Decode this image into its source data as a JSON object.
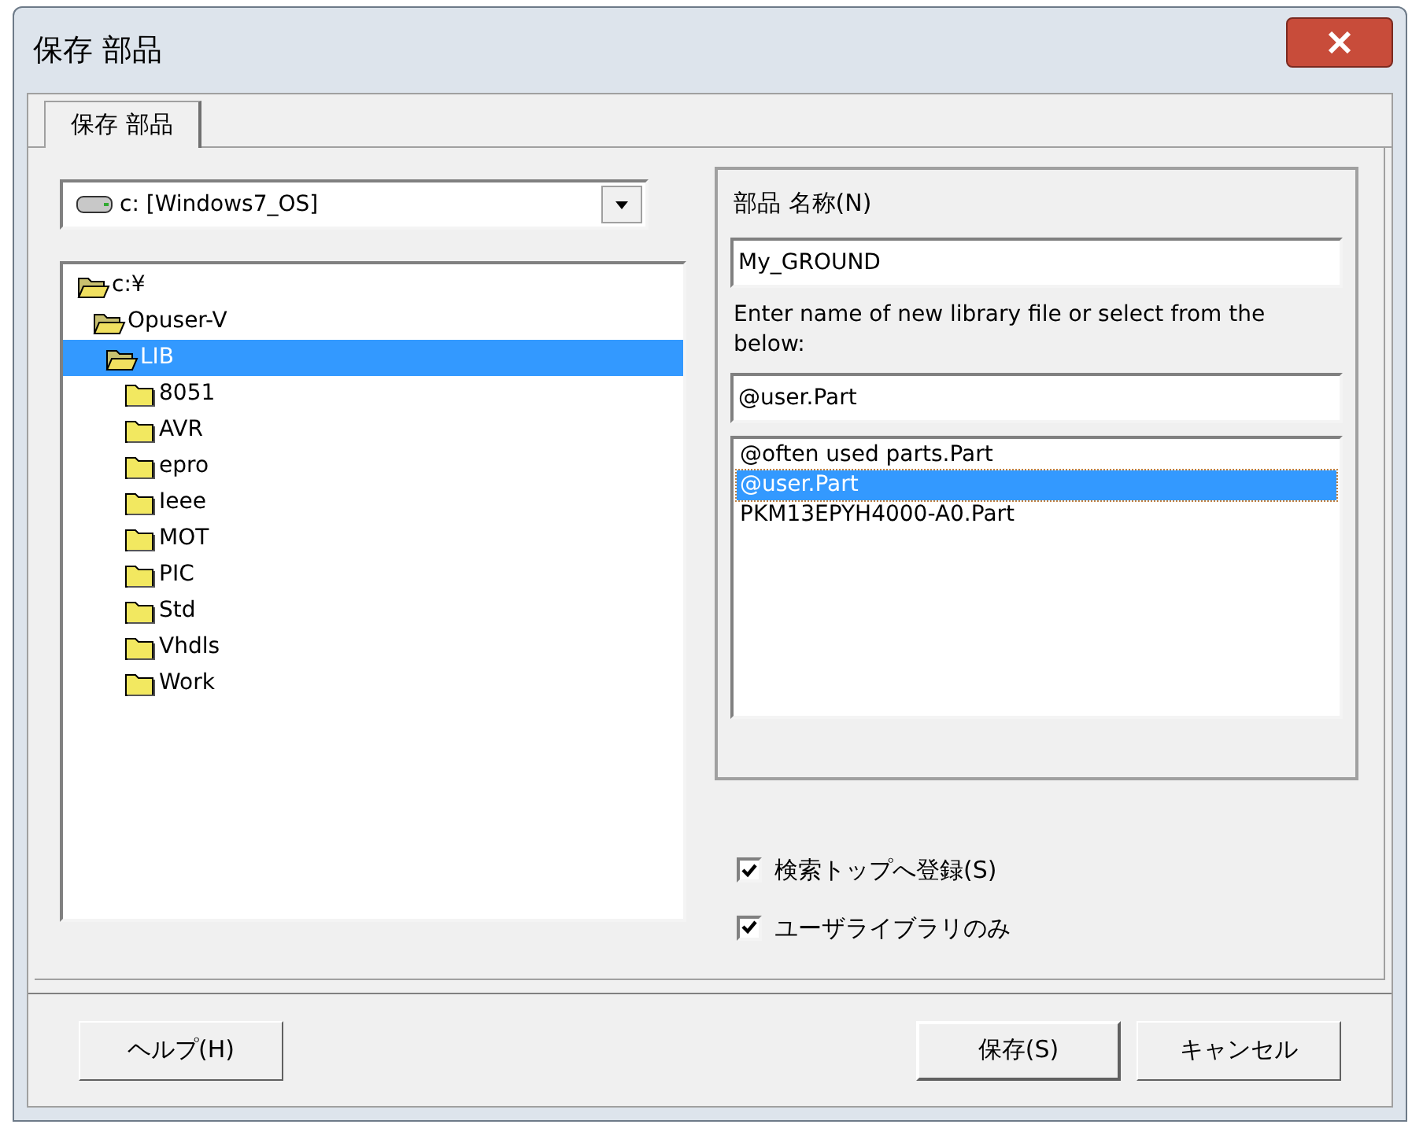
{
  "window": {
    "title": "保存 部品"
  },
  "tabs": [
    {
      "label": "保存 部品",
      "selected": true
    }
  ],
  "drive_combo": {
    "value": "c: [Windows7_OS]"
  },
  "tree": [
    {
      "label": "c:¥",
      "expanded": true,
      "selected": false,
      "children": [
        {
          "label": "Opuser-V",
          "expanded": true,
          "selected": false,
          "children": [
            {
              "label": "LIB",
              "expanded": true,
              "selected": true,
              "children": [
                {
                  "label": "8051",
                  "expanded": false,
                  "selected": false
                },
                {
                  "label": "AVR",
                  "expanded": false,
                  "selected": false
                },
                {
                  "label": "epro",
                  "expanded": false,
                  "selected": false
                },
                {
                  "label": "Ieee",
                  "expanded": false,
                  "selected": false
                },
                {
                  "label": "MOT",
                  "expanded": false,
                  "selected": false
                },
                {
                  "label": "PIC",
                  "expanded": false,
                  "selected": false
                },
                {
                  "label": "Std",
                  "expanded": false,
                  "selected": false
                },
                {
                  "label": "Vhdls",
                  "expanded": false,
                  "selected": false
                },
                {
                  "label": "Work",
                  "expanded": false,
                  "selected": false
                }
              ]
            }
          ]
        }
      ]
    }
  ],
  "part_name": {
    "label": "部品 名称(N)",
    "value": "My_GROUND"
  },
  "library": {
    "label": "Enter name of new library file or select from the below:",
    "value": "@user.Part",
    "items": [
      {
        "label": "@often used parts.Part",
        "selected": false
      },
      {
        "label": "@user.Part",
        "selected": true
      },
      {
        "label": "PKM13EPYH4000-A0.Part",
        "selected": false
      }
    ]
  },
  "checkboxes": [
    {
      "label": "検索トップへ登録(S)",
      "checked": true
    },
    {
      "label": "ユーザライブラリのみ",
      "checked": true
    }
  ],
  "buttons": [
    {
      "label": "ヘルプ(H)",
      "kind": "help"
    },
    {
      "label": "保存(S)",
      "kind": "default"
    },
    {
      "label": "キャンセル",
      "kind": "normal"
    }
  ]
}
